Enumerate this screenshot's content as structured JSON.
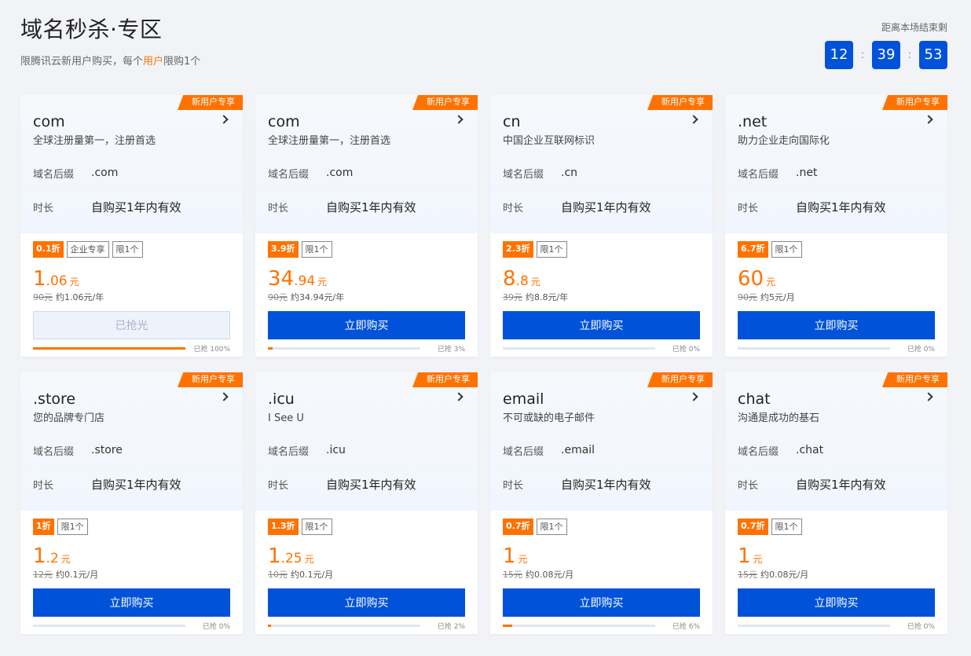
{
  "header": {
    "title": "域名秒杀·专区",
    "subtitle_pre": "限腾讯云新用户购买，每个",
    "subtitle_hl": "用户",
    "subtitle_post": "限购1个"
  },
  "countdown": {
    "label": "距离本场结束剩",
    "hours": "12",
    "minutes": "39",
    "seconds": "53",
    "sep": ":"
  },
  "colors": {
    "accent_orange": "#ff7200",
    "brand_blue": "#0052d9",
    "background": "#f1f3f7"
  },
  "labels": {
    "suffix": "域名后缀",
    "duration": "时长",
    "ribbon": "新用户专享",
    "buy": "立即购买",
    "sold_out": "已抢光",
    "sold_prefix": "已抢 ",
    "unit": "元",
    "approx": "约"
  },
  "cards": [
    {
      "name": "com",
      "desc": "全球注册量第一，注册首选",
      "suffix": ".com",
      "duration": "自购买1年内有效",
      "discount": "0.1折",
      "extra_tag": "企业专享",
      "limit": "限1个",
      "price_int": "1",
      "price_dec": ".06",
      "orig": "90元",
      "per": "约1.06元/年",
      "sold_out": true,
      "sold_percent": 100,
      "sold_text": "已抢 100%"
    },
    {
      "name": "com",
      "desc": "全球注册量第一，注册首选",
      "suffix": ".com",
      "duration": "自购买1年内有效",
      "discount": "3.9折",
      "extra_tag": "",
      "limit": "限1个",
      "price_int": "34",
      "price_dec": ".94",
      "orig": "90元",
      "per": "约34.94元/年",
      "sold_out": false,
      "sold_percent": 3,
      "sold_text": "已抢 3%"
    },
    {
      "name": "cn",
      "desc": "中国企业互联网标识",
      "suffix": ".cn",
      "duration": "自购买1年内有效",
      "discount": "2.3折",
      "extra_tag": "",
      "limit": "限1个",
      "price_int": "8",
      "price_dec": ".8",
      "orig": "39元",
      "per": "约8.8元/年",
      "sold_out": false,
      "sold_percent": 0,
      "sold_text": "已抢 0%"
    },
    {
      "name": ".net",
      "desc": "助力企业走向国际化",
      "suffix": ".net",
      "duration": "自购买1年内有效",
      "discount": "6.7折",
      "extra_tag": "",
      "limit": "限1个",
      "price_int": "60",
      "price_dec": "",
      "orig": "90元",
      "per": "约5元/月",
      "sold_out": false,
      "sold_percent": 0,
      "sold_text": "已抢 0%"
    },
    {
      "name": ".store",
      "desc": "您的品牌专门店",
      "suffix": ".store",
      "duration": "自购买1年内有效",
      "discount": "1折",
      "extra_tag": "",
      "limit": "限1个",
      "price_int": "1",
      "price_dec": ".2",
      "orig": "12元",
      "per": "约0.1元/月",
      "sold_out": false,
      "sold_percent": 0,
      "sold_text": "已抢 0%"
    },
    {
      "name": ".icu",
      "desc": "I See U",
      "suffix": ".icu",
      "duration": "自购买1年内有效",
      "discount": "1.3折",
      "extra_tag": "",
      "limit": "限1个",
      "price_int": "1",
      "price_dec": ".25",
      "orig": "10元",
      "per": "约0.1元/月",
      "sold_out": false,
      "sold_percent": 2,
      "sold_text": "已抢 2%"
    },
    {
      "name": "email",
      "desc": "不可或缺的电子邮件",
      "suffix": ".email",
      "duration": "自购买1年内有效",
      "discount": "0.7折",
      "extra_tag": "",
      "limit": "限1个",
      "price_int": "1",
      "price_dec": "",
      "orig": "15元",
      "per": "约0.08元/月",
      "sold_out": false,
      "sold_percent": 6,
      "sold_text": "已抢 6%"
    },
    {
      "name": "chat",
      "desc": "沟通是成功的基石",
      "suffix": ".chat",
      "duration": "自购买1年内有效",
      "discount": "0.7折",
      "extra_tag": "",
      "limit": "限1个",
      "price_int": "1",
      "price_dec": "",
      "orig": "15元",
      "per": "约0.08元/月",
      "sold_out": false,
      "sold_percent": 0,
      "sold_text": "已抢 0%"
    }
  ]
}
